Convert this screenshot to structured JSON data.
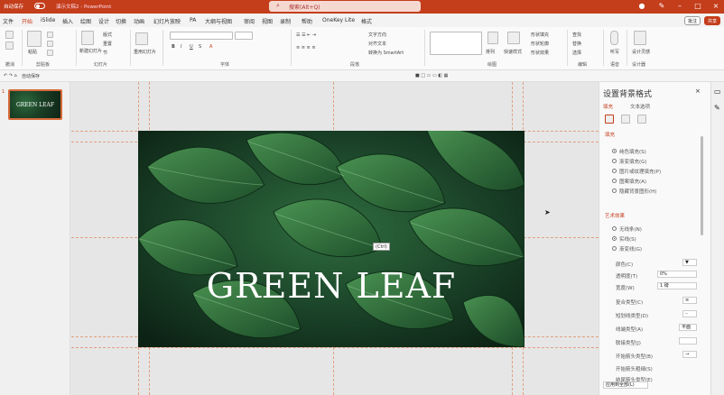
{
  "titlebar": {
    "autosave_label": "自动保存",
    "file_name": "演示文稿2 - PowerPoint",
    "search_placeholder": "搜索(Alt+Q)",
    "minimize": "–",
    "restore": "□",
    "close": "×"
  },
  "menu": {
    "tabs": [
      "文件",
      "开始",
      "iSlide",
      "插入",
      "绘图",
      "设计",
      "切换",
      "动画",
      "幻灯片放映",
      "PA",
      "大纲与视图",
      "审阅",
      "视图",
      "录制",
      "帮助",
      "OneKey Lite",
      "格式"
    ],
    "active_tab": "开始",
    "comments_label": "批注",
    "share_label": "共享"
  },
  "ribbon": {
    "groups": [
      {
        "label": "撤消"
      },
      {
        "label": "剪贴板"
      },
      {
        "label": "幻灯片"
      },
      {
        "label": "字体"
      },
      {
        "label": "段落"
      },
      {
        "label": "绘图"
      },
      {
        "label": "编辑"
      },
      {
        "label": "语音"
      },
      {
        "label": "设计器"
      }
    ],
    "paste_label": "粘贴",
    "new_slide_label": "新建幻灯片",
    "reuse_label": "重用幻灯片",
    "layout_label": "版式",
    "reset_label": "重置",
    "section_label": "节",
    "find_label": "查找",
    "replace_label": "替换",
    "select_label": "选择",
    "dictate_label": "听写",
    "designer_label": "设计灵感",
    "shape_fill": "形状填充",
    "shape_outline": "形状轮廓",
    "shape_effect": "形状效果",
    "arrange_label": "排列",
    "quick_styles": "快速样式",
    "text_direction": "文字方向",
    "align_text": "对齐文本",
    "smartart": "转换为 SmartArt"
  },
  "toolbar2": {
    "zoom_label": "自动保存"
  },
  "thumbnail": {
    "slide_number": "1",
    "text": "GREEN LEAF"
  },
  "slide": {
    "title": "GREEN LEAF",
    "paste_badge": "(Ctrl)"
  },
  "format_pane": {
    "title": "设置背景格式",
    "tabs": [
      "填充",
      "文本选项"
    ],
    "fill_section": "填充",
    "fill_options": [
      "纯色填充(S)",
      "渐变填充(G)",
      "图片或纹理填充(P)",
      "图案填充(A)",
      "隐藏背景图形(H)"
    ],
    "art_section": "艺术效果",
    "color_options": [
      "无线条(N)",
      "实线(S)",
      "渐变线(G)"
    ],
    "props": [
      {
        "label": "颜色(C)",
        "value": ""
      },
      {
        "label": "透明度(T)",
        "value": "0%"
      },
      {
        "label": "宽度(W)",
        "value": "1 磅"
      },
      {
        "label": "复合类型(C)",
        "value": ""
      },
      {
        "label": "短划线类型(D)",
        "value": ""
      },
      {
        "label": "线端类型(A)",
        "value": "平面"
      },
      {
        "label": "联接类型(J)",
        "value": ""
      },
      {
        "label": "开始箭头类型(B)",
        "value": ""
      },
      {
        "label": "开始箭头粗细(S)",
        "value": ""
      },
      {
        "label": "结尾箭头类型(E)",
        "value": ""
      }
    ],
    "apply_all_label": "应用到全部(L)"
  }
}
